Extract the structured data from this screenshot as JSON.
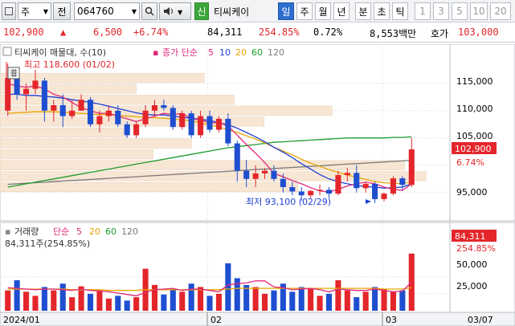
{
  "toolbar": {
    "market": "주",
    "prefix": "전",
    "code": "064760",
    "stock_name": "티씨케이",
    "tag": "신",
    "periods": [
      "일",
      "주",
      "월",
      "년",
      "분",
      "초",
      "틱"
    ],
    "active_period": "일",
    "intervals": [
      "1",
      "3",
      "5",
      "10",
      "20"
    ]
  },
  "quote": {
    "price": "102,900",
    "change": "6,500",
    "change_pct": "+6.74%",
    "volume": "84,311",
    "volume_ratio": "254.85%",
    "turnover": "0.72%",
    "amount": "8,553백만",
    "ask_label": "호가",
    "ask_price": "103,000"
  },
  "price_chart": {
    "title": "티씨케이 매물대, 수(10)",
    "ma_label": "종가 단순",
    "ma_periods": [
      "5",
      "10",
      "20",
      "60",
      "120"
    ],
    "ma_colors": [
      "#e0287a",
      "#1f3fd6",
      "#e8a600",
      "#1d9c2c",
      "#7a7a7a"
    ],
    "high_note": "최고 118,600 (01/02)",
    "low_note": "최저 93,100 (02/29)",
    "y_ticks": [
      "115,000",
      "110,000",
      "105,000",
      "95,000"
    ],
    "current_price_tag": "102,900",
    "current_pct_tag": "6.74%"
  },
  "volume_chart": {
    "title": "거래량",
    "ma_label": "단순",
    "ma_periods": [
      "5",
      "20",
      "60",
      "120"
    ],
    "value_text": "84,311주(254.85%)",
    "y_ticks": [
      "50,000",
      "25,000"
    ],
    "current_volume_tag": "84,311",
    "current_pct_tag": "254.85%"
  },
  "x_axis": {
    "labels": [
      "2024/01",
      "02",
      "03"
    ],
    "end_label": "03/07"
  },
  "chart_data": {
    "type": "candlestick",
    "dates": [
      "01/02",
      "01/03",
      "01/04",
      "01/05",
      "01/08",
      "01/09",
      "01/10",
      "01/11",
      "01/12",
      "01/15",
      "01/16",
      "01/17",
      "01/18",
      "01/19",
      "01/22",
      "01/23",
      "01/24",
      "01/25",
      "01/26",
      "01/29",
      "01/30",
      "01/31",
      "02/01",
      "02/02",
      "02/05",
      "02/06",
      "02/07",
      "02/08",
      "02/13",
      "02/14",
      "02/15",
      "02/16",
      "02/19",
      "02/20",
      "02/21",
      "02/22",
      "02/23",
      "02/26",
      "02/27",
      "02/28",
      "02/29",
      "03/04",
      "03/05",
      "03/06",
      "03/07"
    ],
    "ohlc": [
      [
        110,
        118.6,
        109,
        116
      ],
      [
        116,
        117,
        112,
        113
      ],
      [
        113,
        115,
        110,
        114
      ],
      [
        114,
        117.5,
        113,
        115.5
      ],
      [
        115.5,
        116,
        108,
        110
      ],
      [
        110,
        112,
        108,
        111
      ],
      [
        111,
        113,
        107,
        109
      ],
      [
        109,
        112,
        108.5,
        110
      ],
      [
        110,
        113,
        110,
        112
      ],
      [
        112,
        112.5,
        107,
        107.5
      ],
      [
        107.5,
        110,
        106,
        109
      ],
      [
        109,
        111,
        108,
        110
      ],
      [
        110,
        111,
        107,
        107.5
      ],
      [
        107.5,
        108,
        105,
        105.5
      ],
      [
        105.5,
        108,
        105,
        107.5
      ],
      [
        107.5,
        111,
        107,
        110
      ],
      [
        110,
        112,
        109,
        111
      ],
      [
        111,
        112,
        110,
        110.5
      ],
      [
        110.5,
        111,
        106.5,
        107
      ],
      [
        107,
        110,
        106.5,
        109.5
      ],
      [
        109.5,
        110,
        105,
        105.5
      ],
      [
        105.5,
        110,
        105,
        109
      ],
      [
        109,
        110,
        106,
        106.5
      ],
      [
        106.5,
        109,
        106,
        108.5
      ],
      [
        108.5,
        109.5,
        103.5,
        104
      ],
      [
        104,
        104.5,
        97,
        99
      ],
      [
        99,
        101,
        96,
        97.5
      ],
      [
        97.5,
        100,
        96,
        98.5
      ],
      [
        98.5,
        99.5,
        97.5,
        99
      ],
      [
        99,
        100,
        97,
        97.5
      ],
      [
        97.5,
        98.5,
        95,
        96
      ],
      [
        96,
        97,
        94.5,
        95.2
      ],
      [
        95.2,
        96,
        93.5,
        94.5
      ],
      [
        94.5,
        95.5,
        94,
        95.3
      ],
      [
        95.3,
        96.5,
        94.5,
        95.5
      ],
      [
        95.5,
        96,
        94,
        94.8
      ],
      [
        94.8,
        99,
        94.5,
        98.2
      ],
      [
        98.2,
        99.5,
        97,
        98.6
      ],
      [
        98.6,
        100,
        95,
        95.8
      ],
      [
        95.8,
        97,
        95,
        96.6
      ],
      [
        96.6,
        97,
        93.1,
        93.8
      ],
      [
        93.8,
        95,
        93.4,
        94.8
      ],
      [
        94.8,
        98,
        94.5,
        97.6
      ],
      [
        97.6,
        98,
        95.5,
        96.4
      ],
      [
        96.4,
        105,
        96,
        102.9
      ]
    ],
    "volume": [
      30,
      45,
      28,
      22,
      35,
      30,
      40,
      20,
      36,
      25,
      30,
      18,
      22,
      15,
      20,
      62,
      38,
      24,
      32,
      28,
      40,
      35,
      22,
      25,
      70,
      48,
      38,
      35,
      25,
      30,
      40,
      28,
      35,
      32,
      22,
      25,
      45,
      30,
      20,
      28,
      35,
      32,
      28,
      30,
      84.3
    ],
    "ylim": [
      91,
      121
    ],
    "volume_ylim": [
      0,
      90
    ],
    "ma5": [
      115,
      114.5,
      114.3,
      114.5,
      114,
      113,
      112.5,
      111.5,
      110.5,
      110,
      109.5,
      109.5,
      109,
      108.5,
      108,
      108.5,
      109,
      109.5,
      109.3,
      109.5,
      108.5,
      108.3,
      107.8,
      107.8,
      107.2,
      105.5,
      103.8,
      102.2,
      100.5,
      98.5,
      97.9,
      97.2,
      96.6,
      95.9,
      95.3,
      95.1,
      95.6,
      96.2,
      96.6,
      96.9,
      96.6,
      96.0,
      95.6,
      95.4,
      96.6
    ],
    "ma10": [
      113,
      113,
      112.8,
      112.8,
      112.6,
      112.5,
      112.3,
      112,
      111.8,
      111.5,
      111.2,
      110.8,
      110.4,
      110,
      109.6,
      109.3,
      109.2,
      109.2,
      109,
      108.8,
      108.6,
      108.4,
      108.2,
      107.8,
      107.4,
      106.8,
      106,
      105.2,
      104.3,
      103.3,
      102.4,
      101.4,
      100.3,
      99.3,
      98.3,
      97.5,
      97,
      96.6,
      96.3,
      96.1,
      96,
      95.8,
      95.9,
      96.0,
      96.6
    ],
    "ma20": [
      109.5,
      109.6,
      109.7,
      109.8,
      109.8,
      109.8,
      109.7,
      109.6,
      109.5,
      109.4,
      109.3,
      109.2,
      109.1,
      109,
      108.9,
      108.8,
      108.7,
      108.6,
      108.5,
      108.3,
      108.1,
      107.8,
      107.4,
      107,
      106.5,
      106,
      105.4,
      104.8,
      104.1,
      103.3,
      102.6,
      101.9,
      101.1,
      100.4,
      99.8,
      99.2,
      98.7,
      98.2,
      97.8,
      97.4,
      97,
      96.8,
      96.7,
      96.6,
      97
    ],
    "ma60": [
      96,
      96.3,
      96.6,
      96.9,
      97.2,
      97.5,
      97.8,
      98.1,
      98.4,
      98.7,
      99,
      99.3,
      99.6,
      99.9,
      100.2,
      100.5,
      100.8,
      101.1,
      101.4,
      101.7,
      102,
      102.3,
      102.6,
      102.9,
      103.2,
      103.4,
      103.6,
      103.8,
      104,
      104.2,
      104.3,
      104.4,
      104.5,
      104.6,
      104.7,
      104.8,
      104.9,
      105,
      105,
      105,
      105,
      105,
      105.1,
      105.1,
      105.2
    ],
    "ma120": [
      96.5,
      96.6,
      96.7,
      96.8,
      96.9,
      97,
      97.1,
      97.2,
      97.3,
      97.4,
      97.5,
      97.6,
      97.7,
      97.8,
      97.9,
      98,
      98.1,
      98.2,
      98.3,
      98.4,
      98.5,
      98.6,
      98.7,
      98.8,
      98.9,
      99,
      99.1,
      99.2,
      99.3,
      99.4,
      99.5,
      99.6,
      99.7,
      99.8,
      99.9,
      100,
      100.1,
      100.2,
      100.3,
      100.4,
      100.5,
      100.6,
      100.7,
      100.8,
      100.9
    ],
    "vol_ma5": [
      34,
      33,
      32,
      31,
      32,
      32,
      31,
      30,
      32,
      30,
      29,
      28,
      26,
      24,
      22,
      27,
      31,
      32,
      33,
      30,
      32,
      32,
      30,
      28,
      38,
      40,
      41,
      44,
      44,
      35,
      34,
      31,
      32,
      33,
      31,
      28,
      32,
      31,
      30,
      30,
      32,
      30,
      28,
      29,
      42
    ],
    "vol_ma20": [
      32,
      32,
      32,
      32,
      32,
      32,
      32,
      31,
      31,
      31,
      31,
      30,
      30,
      30,
      30,
      31,
      31,
      31,
      31,
      31,
      31,
      31,
      31,
      31,
      32,
      33,
      33,
      33,
      33,
      33,
      33,
      33,
      33,
      33,
      33,
      33,
      33,
      33,
      33,
      33,
      33,
      32,
      32,
      32,
      34
    ],
    "volume_profile": [
      {
        "low": 115,
        "high": 117,
        "weight": 0.48
      },
      {
        "low": 113,
        "high": 115,
        "weight": 0.32
      },
      {
        "low": 111,
        "high": 113,
        "weight": 0.55
      },
      {
        "low": 109,
        "high": 111,
        "weight": 0.78
      },
      {
        "low": 107,
        "high": 109,
        "weight": 0.62
      },
      {
        "low": 105,
        "high": 107,
        "weight": 0.3
      },
      {
        "low": 103,
        "high": 105,
        "weight": 0.45
      },
      {
        "low": 101,
        "high": 103,
        "weight": 0.36
      },
      {
        "low": 99,
        "high": 101,
        "weight": 0.95
      },
      {
        "low": 97,
        "high": 99,
        "weight": 1.0
      },
      {
        "low": 95,
        "high": 97,
        "weight": 0.7
      }
    ]
  }
}
